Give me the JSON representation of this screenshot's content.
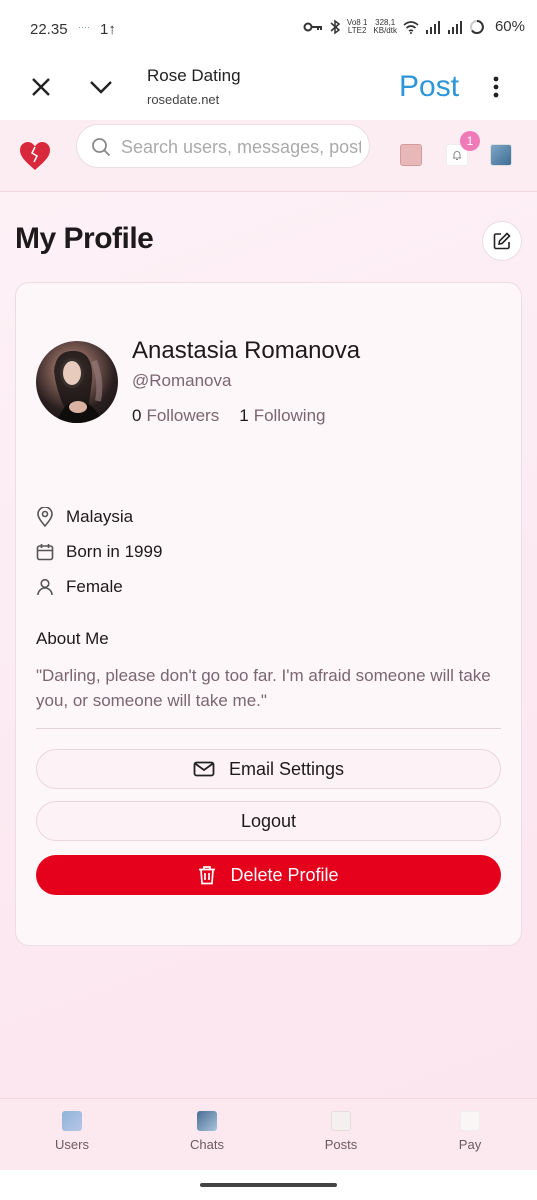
{
  "status_bar": {
    "time": "22.35",
    "mini_text": "····",
    "upload": "1↑",
    "network_line1": "Vo8 1",
    "network_line2": "LTE2",
    "speed_value": "328,1",
    "speed_unit": "KB/dtk",
    "battery": "60%"
  },
  "browser": {
    "site_title": "Rose Dating",
    "site_url": "rosedate.net",
    "post_label": "Post"
  },
  "header": {
    "search_placeholder": "Search users, messages, posts",
    "notification_count": "1"
  },
  "page": {
    "title": "My Profile"
  },
  "profile": {
    "name": "Anastasia Romanova",
    "handle": "@Romanova",
    "followers_count": "0",
    "followers_label": "Followers",
    "following_count": "1",
    "following_label": "Following",
    "location": "Malaysia",
    "birth": "Born in 1999",
    "gender": "Female",
    "about_title": "About Me",
    "about_text": "\"Darling, please don't go too far. I'm afraid someone will take you, or someone will take me.\""
  },
  "actions": {
    "email_settings": "Email Settings",
    "logout": "Logout",
    "delete_profile": "Delete Profile"
  },
  "bottom_nav": {
    "items": [
      {
        "label": "Users",
        "icon": "users-icon"
      },
      {
        "label": "Chats",
        "icon": "chats-icon"
      },
      {
        "label": "Posts",
        "icon": "posts-icon"
      },
      {
        "label": "Pay",
        "icon": "pay-icon"
      }
    ]
  },
  "colors": {
    "accent_blue": "#2c96d8",
    "danger": "#e5001b",
    "badge": "#f07ab8",
    "logo_red": "#d8283c"
  }
}
